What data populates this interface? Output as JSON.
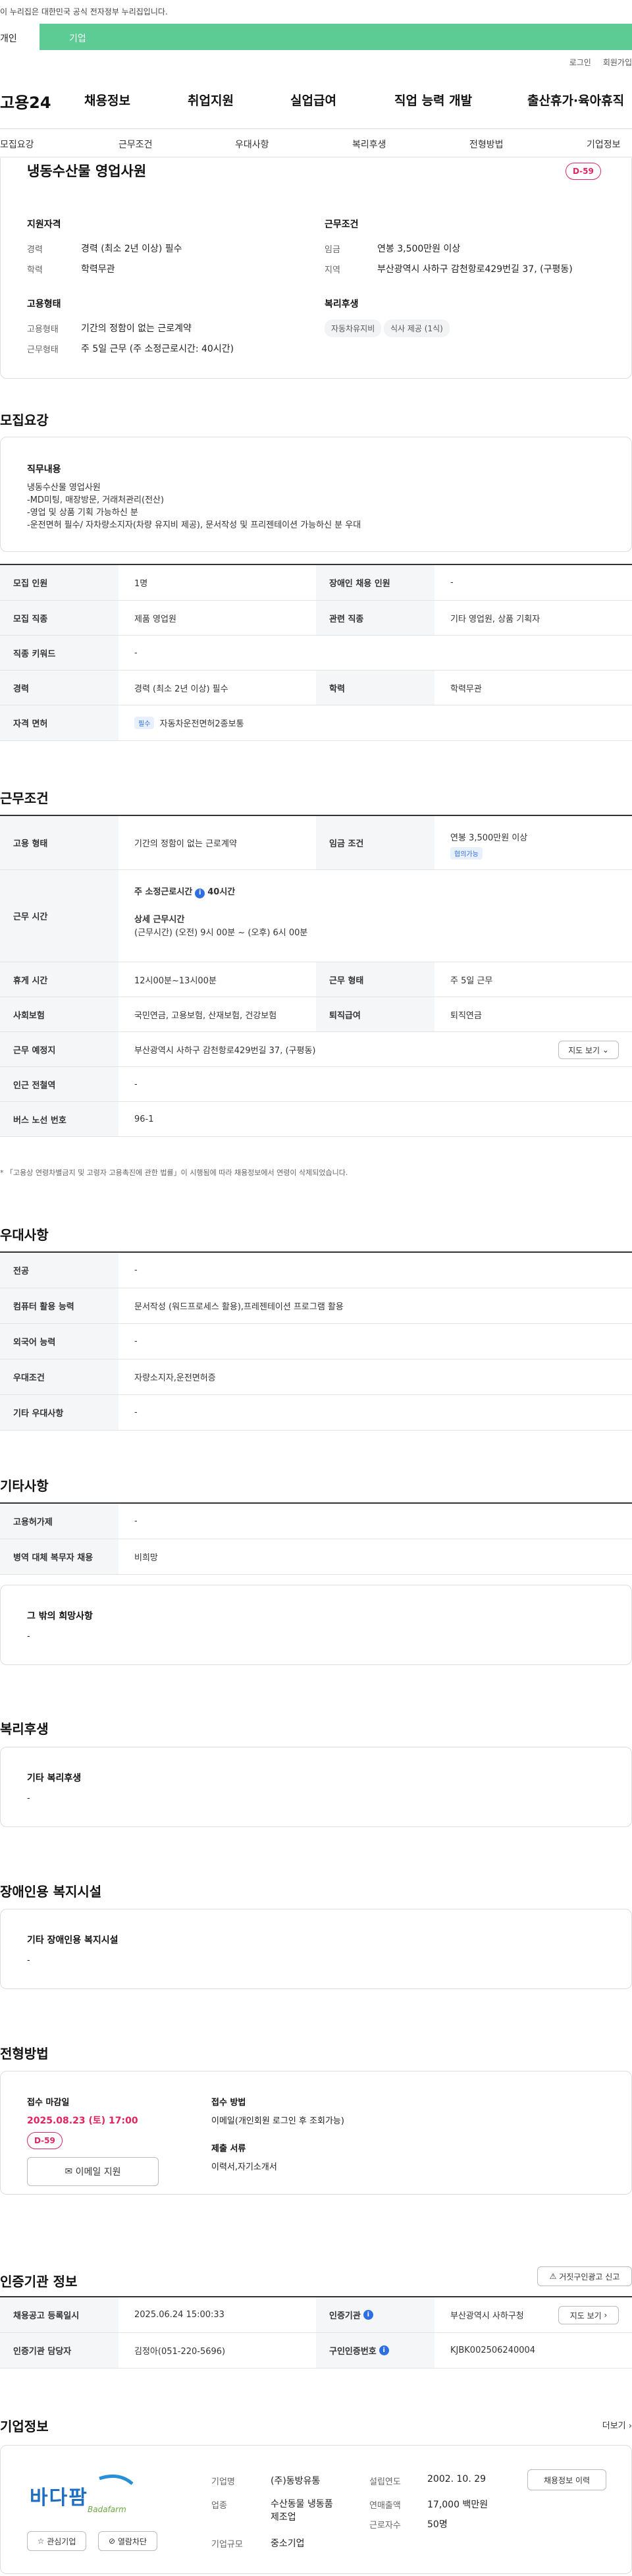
{
  "gov_banner": "이 누리집은 대한민국 공식 전자정부 누리집입니다.",
  "top_tabs": [
    "개인",
    "기업"
  ],
  "util": {
    "login": "로그인",
    "join": "회원가입"
  },
  "logo": "고용24",
  "gnb": [
    "채용정보",
    "취업지원",
    "실업급여",
    "직업 능력 개발",
    "출산휴가·육아휴직"
  ],
  "subnav": [
    "모집요강",
    "근무조건",
    "우대사항",
    "복리후생",
    "전형방법",
    "기업정보"
  ],
  "summary": {
    "title": "냉동수산물 영업사원",
    "dday": "D-59",
    "qual_h": "지원자격",
    "career_l": "경력",
    "career_v": "경력 (최소 2년 이상) 필수",
    "edu_l": "학력",
    "edu_v": "학력무관",
    "cond_h": "근무조건",
    "wage_l": "임금",
    "wage_v": "연봉 3,500만원 이상",
    "area_l": "지역",
    "area_v": "부산광역시 사하구 감천항로429번길 37, (구평동)",
    "emp_h": "고용형태",
    "emp_l": "고용형태",
    "emp_v": "기간의 정함이 없는 근로계약",
    "work_l": "근무형태",
    "work_v": "주 5일 근무 (주 소정근로시간: 40시간)",
    "wel_h": "복리후생",
    "wel_chips": [
      "자동차유지비",
      "식사 제공 (1식)"
    ]
  },
  "recruit": {
    "title": "모집요강",
    "duty_h": "직무내용",
    "duty_lines": [
      "냉동수산물 영업사원",
      "-MD미팅, 매장방문, 거래처관리(전산)",
      "-영업 및 상품 기획 가능하신 분",
      "-운전면허 필수/ 자차량소지자(차량 유지비 제공), 문서작성 및 프리젠테이션 가능하신 분 우대"
    ],
    "r1": {
      "h1": "모집 인원",
      "v1": "1명",
      "h2": "장애인 채용 인원",
      "v2": "-"
    },
    "r2": {
      "h1": "모집 직종",
      "v1": "제품 영업원",
      "h2": "관련 직종",
      "v2": "기타 영업원, 상품 기획자"
    },
    "r3": {
      "h1": "직종 키워드",
      "v1": "-"
    },
    "r4": {
      "h1": "경력",
      "v1": "경력 (최소 2년 이상) 필수",
      "h2": "학력",
      "v2": "학력무관"
    },
    "r5": {
      "h1": "자격 면허",
      "tag": "필수",
      "v1": "자동차운전면허2종보통"
    }
  },
  "work": {
    "title": "근무조건",
    "r1": {
      "h1": "고용 형태",
      "v1": "기간의 정함이 없는 근로계약",
      "h2": "임금 조건",
      "v2": "연봉 3,500만원 이상",
      "v2tag": "협의가능"
    },
    "r2": {
      "h1": "근무 시간",
      "l1": "주 소정근로시간",
      "l1b": "40시간",
      "l2": "상세 근무시간",
      "l3": "(근무시간) (오전) 9시 00분 ~ (오후) 6시 00분"
    },
    "r3": {
      "h1": "휴게 시간",
      "v1": "12시00분~13시00분",
      "h2": "근무 형태",
      "v2": "주 5일 근무"
    },
    "r4": {
      "h1": "사회보험",
      "v1": "국민연금, 고용보험, 산재보험, 건강보험",
      "h2": "퇴직급여",
      "v2": "퇴직연금"
    },
    "r5": {
      "h1": "근무 예정지",
      "v1": "부산광역시 사하구 감천항로429번길 37, (구평동)",
      "btn": "지도 보기"
    },
    "r6": {
      "h1": "인근 전철역",
      "v1": "-"
    },
    "r7": {
      "h1": "버스 노선 번호",
      "v1": "96-1"
    },
    "note": "* 「고용상 연령차별금지 및 고령자 고용촉진에 관한 법률」이 시행됨에 따라 채용정보에서 연령이 삭제되었습니다."
  },
  "pref": {
    "title": "우대사항",
    "rows": [
      {
        "h": "전공",
        "v": "-"
      },
      {
        "h": "컴퓨터 활용 능력",
        "v": "문서작성 (워드프로세스 활용),프레젠테이션 프로그램 활용"
      },
      {
        "h": "외국어 능력",
        "v": "-"
      },
      {
        "h": "우대조건",
        "v": "자량소지자,운전면허증"
      },
      {
        "h": "기타 우대사항",
        "v": "-"
      }
    ]
  },
  "etc": {
    "title": "기타사항",
    "rows": [
      {
        "h": "고용허가제",
        "v": "-"
      },
      {
        "h": "병역 대체 복무자 채용",
        "v": "비희망"
      }
    ],
    "other_h": "그 밖의 희망사항",
    "other_v": "-"
  },
  "welfare": {
    "title": "복리후생",
    "card_h": "기타 복리후생",
    "card_v": "-"
  },
  "disab": {
    "title": "장애인용 복지시설",
    "card_h": "기타 장애인용 복지시설",
    "card_v": "-"
  },
  "select": {
    "title": "전형방법",
    "deadline_l": "접수 마감일",
    "deadline_v": "2025.08.23 (토) 17:00",
    "dday": "D-59",
    "apply_btn": "이메일 지원",
    "method_l": "접수 방법",
    "method_v": "이메일(개인회원 로그인 후 조회가능)",
    "docs_l": "제출 서류",
    "docs_v": "이력서,자기소개서"
  },
  "cert": {
    "title": "인증기관 정보",
    "report_btn": "거짓구인광고 신고",
    "r1": {
      "h1": "채용공고 등록일시",
      "v1": "2025.06.24 15:00:33",
      "h2": "인증기관",
      "v2": "부산광역시 사하구청",
      "btn": "지도 보기"
    },
    "r2": {
      "h1": "인증기관 담당자",
      "v1": "김정아(051-220-5696)",
      "h2": "구인인증번호",
      "v2": "KJBK002506240004"
    }
  },
  "company": {
    "title": "기업정보",
    "more": "더보기",
    "logo_text": "바다팜",
    "logo_sub": "Badafarm",
    "fav_btn": "관심기업",
    "block_btn": "열람차단",
    "name_l": "기업명",
    "name_v": "(주)동방유통",
    "ind_l": "업종",
    "ind_v1": "수산동물 냉동품",
    "ind_v2": "제조업",
    "size_l": "기업규모",
    "size_v": "중소기업",
    "est_l": "설립연도",
    "est_v": "2002. 10. 29",
    "sales_l": "연매출액",
    "sales_v": "17,000 백만원",
    "emp_l": "근로자수",
    "emp_v": "50명",
    "hist_btn": "채용정보 이력"
  }
}
